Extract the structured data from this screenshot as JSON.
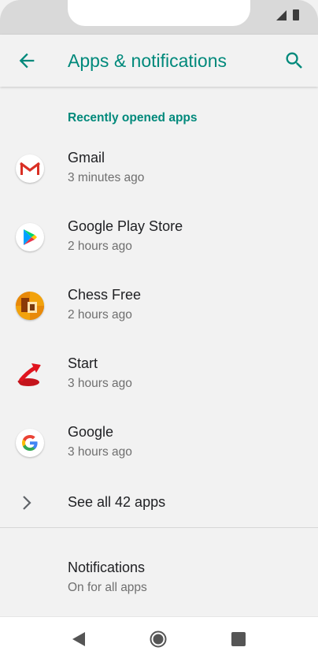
{
  "app_bar": {
    "title": "Apps & notifications",
    "back_icon": "arrow-back-icon",
    "search_icon": "search-icon",
    "accent_color": "#00897b"
  },
  "section": {
    "header": "Recently opened apps"
  },
  "apps": [
    {
      "name": "Gmail",
      "time": "3 minutes ago",
      "icon": "gmail-icon"
    },
    {
      "name": "Google Play Store",
      "time": "2 hours ago",
      "icon": "play-store-icon"
    },
    {
      "name": "Chess Free",
      "time": "2 hours ago",
      "icon": "chess-icon"
    },
    {
      "name": "Start",
      "time": "3 hours ago",
      "icon": "start-icon"
    },
    {
      "name": "Google",
      "time": "3 hours ago",
      "icon": "google-icon"
    }
  ],
  "see_all": {
    "label": "See all 42 apps",
    "icon": "chevron-right-icon"
  },
  "notifications": {
    "title": "Notifications",
    "subtitle": "On for all apps"
  },
  "nav_bar": {
    "back_icon": "nav-back-icon",
    "home_icon": "nav-home-icon",
    "recents_icon": "nav-recents-icon"
  }
}
